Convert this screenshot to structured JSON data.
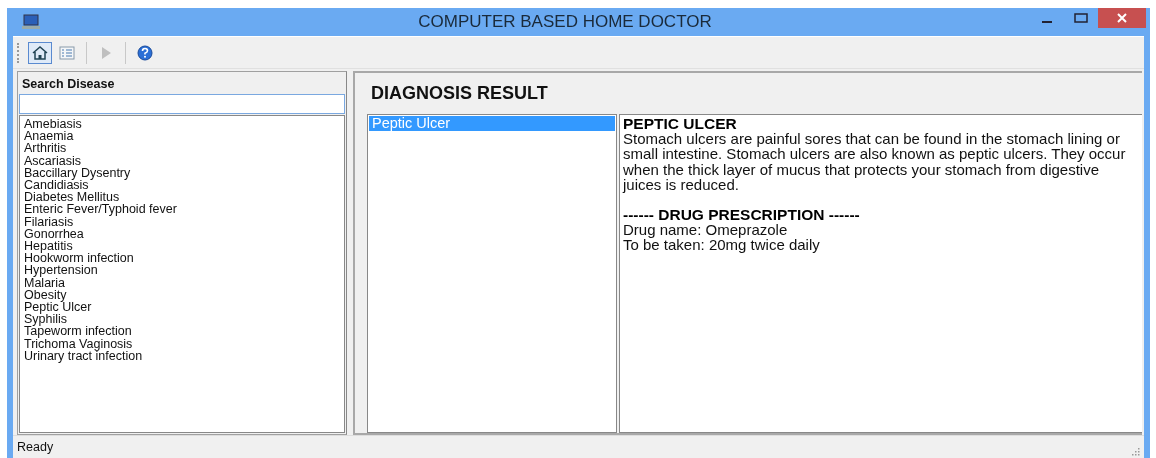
{
  "window": {
    "title": "COMPUTER BASED HOME DOCTOR"
  },
  "toolbar": [
    {
      "kind": "home",
      "selected": true,
      "disabled": false
    },
    {
      "kind": "list",
      "selected": false,
      "disabled": false
    },
    {
      "kind": "play",
      "selected": false,
      "disabled": true
    },
    {
      "kind": "help",
      "selected": false,
      "disabled": false
    }
  ],
  "search": {
    "label": "Search Disease"
  },
  "diseases": [
    "Amebiasis",
    "Anaemia",
    "Arthritis",
    "Ascariasis",
    "Baccillary Dysentry",
    "Candidiasis",
    "Diabetes Mellitus",
    "Enteric Fever/Typhoid fever",
    "Filariasis",
    "Gonorrhea",
    "Hepatitis",
    "Hookworm infection",
    "Hypertension",
    "Malaria",
    "Obesity",
    "Peptic Ulcer",
    "Syphilis",
    "Tapeworm infection",
    "Trichoma Vaginosis",
    "Urinary tract infection"
  ],
  "diagnosis": {
    "title": "DIAGNOSIS RESULT",
    "results": [
      {
        "label": "Peptic Ulcer",
        "selected": true
      }
    ],
    "detail": {
      "heading": "PEPTIC ULCER",
      "description": "Stomach ulcers are painful sores that can be found in the stomach lining or small intestine. Stomach ulcers are also known as peptic ulcers. They occur when the thick layer of mucus that protects your stomach from digestive juices is reduced.",
      "prescription_heading": "------ DRUG PRESCRIPTION ------",
      "lines": [
        "Drug name: Omeprazole",
        "To be taken: 20mg twice daily"
      ]
    }
  },
  "status_bar": {
    "text": "Ready"
  }
}
